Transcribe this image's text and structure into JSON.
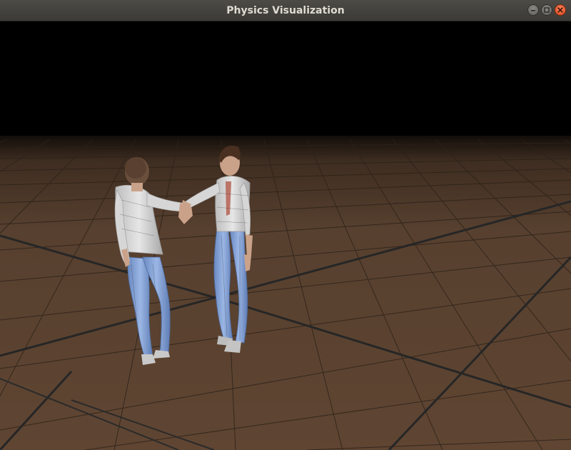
{
  "window": {
    "title": "Physics Visualization",
    "controls": {
      "minimize_icon": "minimize-icon",
      "maximize_icon": "maximize-icon",
      "close_icon": "close-icon"
    }
  },
  "scene": {
    "sky_color": "#000000",
    "floor_color": "#5e4331",
    "grid_line_color": "#2a2018",
    "characters": [
      {
        "shirt_color": "#d8d8d8",
        "jeans_color": "#7f9fd6",
        "skin_color": "#caa28a",
        "hair_color": "#5a4030"
      },
      {
        "shirt_color": "#d8d8d8",
        "jeans_color": "#7f9fd6",
        "skin_color": "#caa28a",
        "hair_color": "#4a3020"
      }
    ]
  }
}
